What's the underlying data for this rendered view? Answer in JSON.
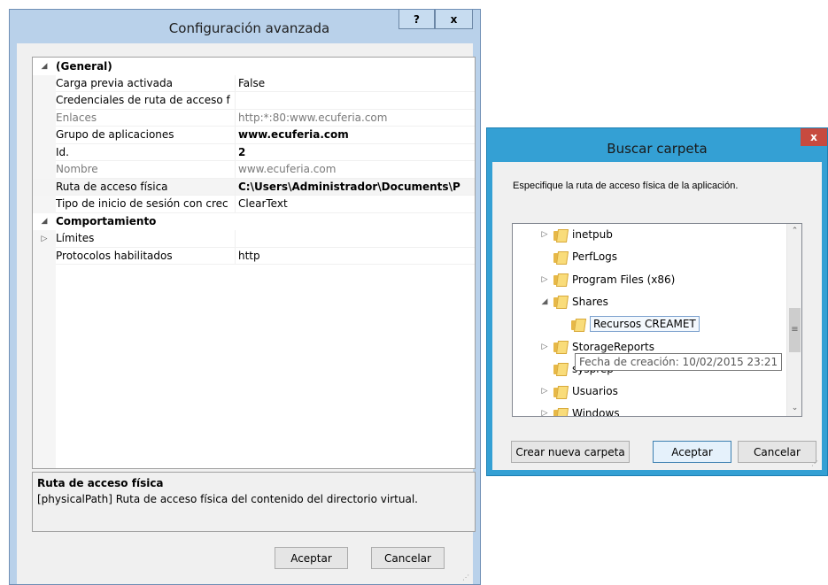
{
  "config_dialog": {
    "title": "Configuración avanzada",
    "help_button": "?",
    "close_button": "x",
    "sections": [
      {
        "label": "(General)",
        "expanded": true,
        "properties": [
          {
            "name": "Carga previa activada",
            "value": "False",
            "style": "normal"
          },
          {
            "name": "Credenciales de ruta de acceso f",
            "value": "",
            "style": "normal"
          },
          {
            "name": "Enlaces",
            "value": "http:*:80:www.ecuferia.com",
            "style": "gray"
          },
          {
            "name": "Grupo de aplicaciones",
            "value": "www.ecuferia.com",
            "style": "bold"
          },
          {
            "name": "Id.",
            "value": "2",
            "style": "bold"
          },
          {
            "name": "Nombre",
            "value": "www.ecuferia.com",
            "style": "gray"
          },
          {
            "name": "Ruta de acceso física",
            "value": "C:\\Users\\Administrador\\Documents\\P",
            "style": "bold"
          },
          {
            "name": "Tipo de inicio de sesión con crec",
            "value": "ClearText",
            "style": "normal"
          }
        ]
      },
      {
        "label": "Comportamiento",
        "expanded": true,
        "properties": [
          {
            "name": "Límites",
            "value": "",
            "style": "normal",
            "expandable": true
          },
          {
            "name": "Protocolos habilitados",
            "value": "http",
            "style": "normal"
          }
        ]
      }
    ],
    "description": {
      "title": "Ruta de acceso física",
      "text": "[physicalPath] Ruta de acceso física del contenido del directorio virtual."
    },
    "ok_button": "Aceptar",
    "cancel_button": "Cancelar"
  },
  "folder_dialog": {
    "title": "Buscar carpeta",
    "close_button": "x",
    "instruction": "Especifique la ruta de acceso física de la aplicación.",
    "tree": [
      {
        "label": "inetpub",
        "indent": 1,
        "toggle": "collapsed"
      },
      {
        "label": "PerfLogs",
        "indent": 1,
        "toggle": "none"
      },
      {
        "label": "Program Files (x86)",
        "indent": 1,
        "toggle": "collapsed"
      },
      {
        "label": "Shares",
        "indent": 1,
        "toggle": "expanded"
      },
      {
        "label": "Recursos CREAMET",
        "indent": 2,
        "toggle": "none",
        "selected": true
      },
      {
        "label": "StorageReports",
        "indent": 1,
        "toggle": "collapsed"
      },
      {
        "label": "sysprep",
        "indent": 1,
        "toggle": "none"
      },
      {
        "label": "Usuarios",
        "indent": 1,
        "toggle": "collapsed"
      },
      {
        "label": "Windows",
        "indent": 1,
        "toggle": "collapsed"
      }
    ],
    "tooltip": "Fecha de creación: 10/02/2015 23:21",
    "new_folder_button": "Crear nueva carpeta",
    "ok_button": "Aceptar",
    "cancel_button": "Cancelar"
  },
  "icons": {
    "folder": "folder-icon",
    "expanded": "◢",
    "collapsed": "▷"
  }
}
